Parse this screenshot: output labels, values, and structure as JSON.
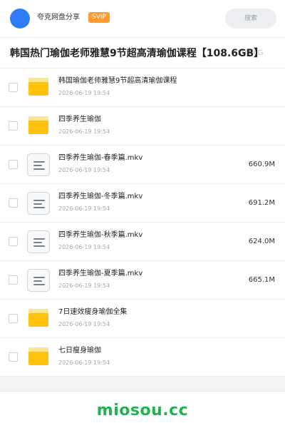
{
  "header": {
    "share_name": "夸克网盘分享",
    "badge": "SVIP",
    "search_label": "搜索"
  },
  "title": {
    "text": "韩国热门瑜伽老师雅慧9节超高清瑜伽课程【108.6GB】",
    "ghost_text": "108.6G"
  },
  "files": [
    {
      "name": "韩国瑜伽老师雅慧9节超高清瑜伽课程",
      "date": "2026-06-19 19:54",
      "size": "",
      "type": "folder"
    },
    {
      "name": "四季养生瑜伽",
      "date": "2026-06-19 19:54",
      "size": "",
      "type": "folder"
    },
    {
      "name": "四季养生瑜伽-春季篇.mkv",
      "date": "2026-06-19 19:54",
      "size": "660.9M",
      "type": "video"
    },
    {
      "name": "四季养生瑜伽-冬季篇.mkv",
      "date": "2026-06-19 19:54",
      "size": "691.2M",
      "type": "video"
    },
    {
      "name": "四季养生瑜伽-秋季篇.mkv",
      "date": "2026-06-19 19:54",
      "size": "624.0M",
      "type": "video"
    },
    {
      "name": "四季养生瑜伽-夏季篇.mkv",
      "date": "2026-06-19 19:54",
      "size": "665.1M",
      "type": "video"
    },
    {
      "name": "7日速效瘦身瑜伽全集",
      "date": "2026-06-19 19:54",
      "size": "",
      "type": "folder"
    },
    {
      "name": "七日瘦身瑜伽",
      "date": "2026-06-19 19:54",
      "size": "",
      "type": "folder"
    }
  ],
  "footer": {
    "brand": "miosou.cc"
  },
  "colors": {
    "accent": "#2f7df6",
    "svip": "#ff9a2e",
    "folder": "#ffc10d",
    "brand": "#21b34d"
  }
}
